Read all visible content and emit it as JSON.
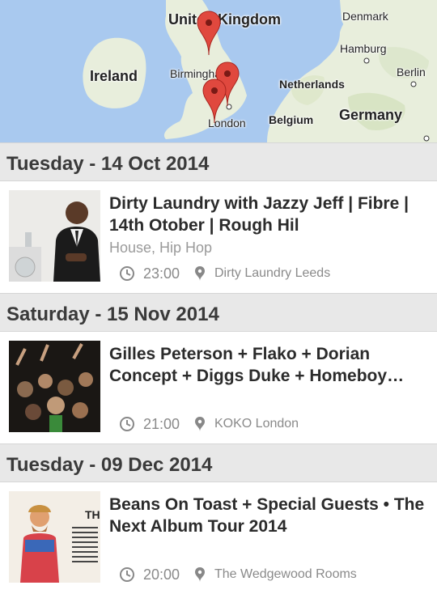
{
  "map": {
    "labels": {
      "united_kingdom": "United Kingdom",
      "ireland": "Ireland",
      "denmark": "Denmark",
      "hamburg": "Hamburg",
      "berlin": "Berlin",
      "netherlands": "Netherlands",
      "germany": "Germany",
      "belgium": "Belgium",
      "birmingham": "Birmingham",
      "london": "London"
    },
    "pin_color": "#e0483e"
  },
  "events": [
    {
      "day": "Tuesday - 14 Oct 2014",
      "title": "Dirty Laundry with Jazzy Jeff | Fibre | 14th Otober | Rough Hil",
      "genre": "House, Hip Hop",
      "time": "23:00",
      "venue": "Dirty Laundry Leeds"
    },
    {
      "day": "Saturday - 15 Nov 2014",
      "title": "Gilles Peterson + Flako + Dorian Concept + Diggs Duke + Homeboy…",
      "genre": "",
      "time": "21:00",
      "venue": "KOKO London"
    },
    {
      "day": "Tuesday - 09 Dec 2014",
      "title": "Beans On Toast + Special Guests • The Next Album Tour 2014",
      "genre": "",
      "time": "20:00",
      "venue": "The Wedgewood Rooms"
    }
  ],
  "icons": {
    "time": "clock-icon",
    "venue": "location-pin-icon"
  }
}
